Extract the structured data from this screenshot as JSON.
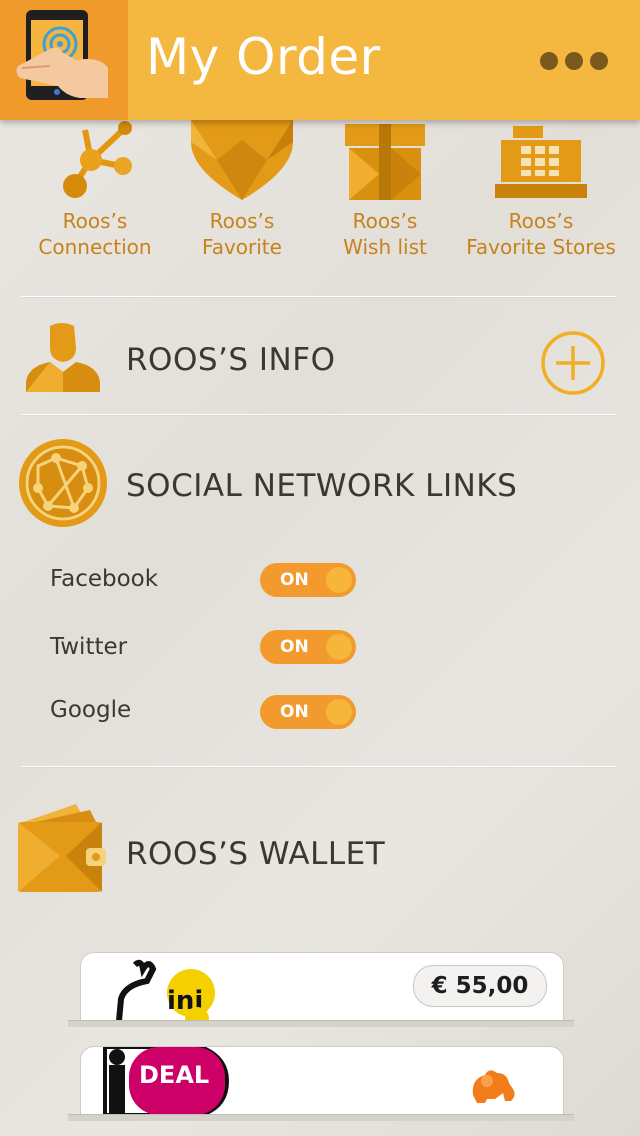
{
  "header": {
    "title": "My Order"
  },
  "shortcuts": [
    {
      "label": "Roos’s\nConnection",
      "icon": "network-icon"
    },
    {
      "label": "Roos’s\nFavorite",
      "icon": "heart-icon"
    },
    {
      "label": "Roos’s\nWish list",
      "icon": "gift-icon"
    },
    {
      "label": "Roos’s\nFavorite Stores",
      "icon": "cash-register-icon"
    }
  ],
  "info": {
    "title": "ROOS’S INFO"
  },
  "social": {
    "title": "SOCIAL NETWORK LINKS",
    "links": [
      {
        "label": "Facebook",
        "state": "ON"
      },
      {
        "label": "Twitter",
        "state": "ON"
      },
      {
        "label": "Google",
        "state": "ON"
      }
    ]
  },
  "wallet": {
    "title": "ROOS’S WALLET",
    "cards": [
      {
        "balance": "€ 55,00"
      },
      {
        "logo_text": "DEAL"
      }
    ]
  },
  "colors": {
    "accent": "#f4b841",
    "accent_dark": "#f09a2c",
    "icon_gold": "#e19a12",
    "toggle": "#f29a2e"
  }
}
